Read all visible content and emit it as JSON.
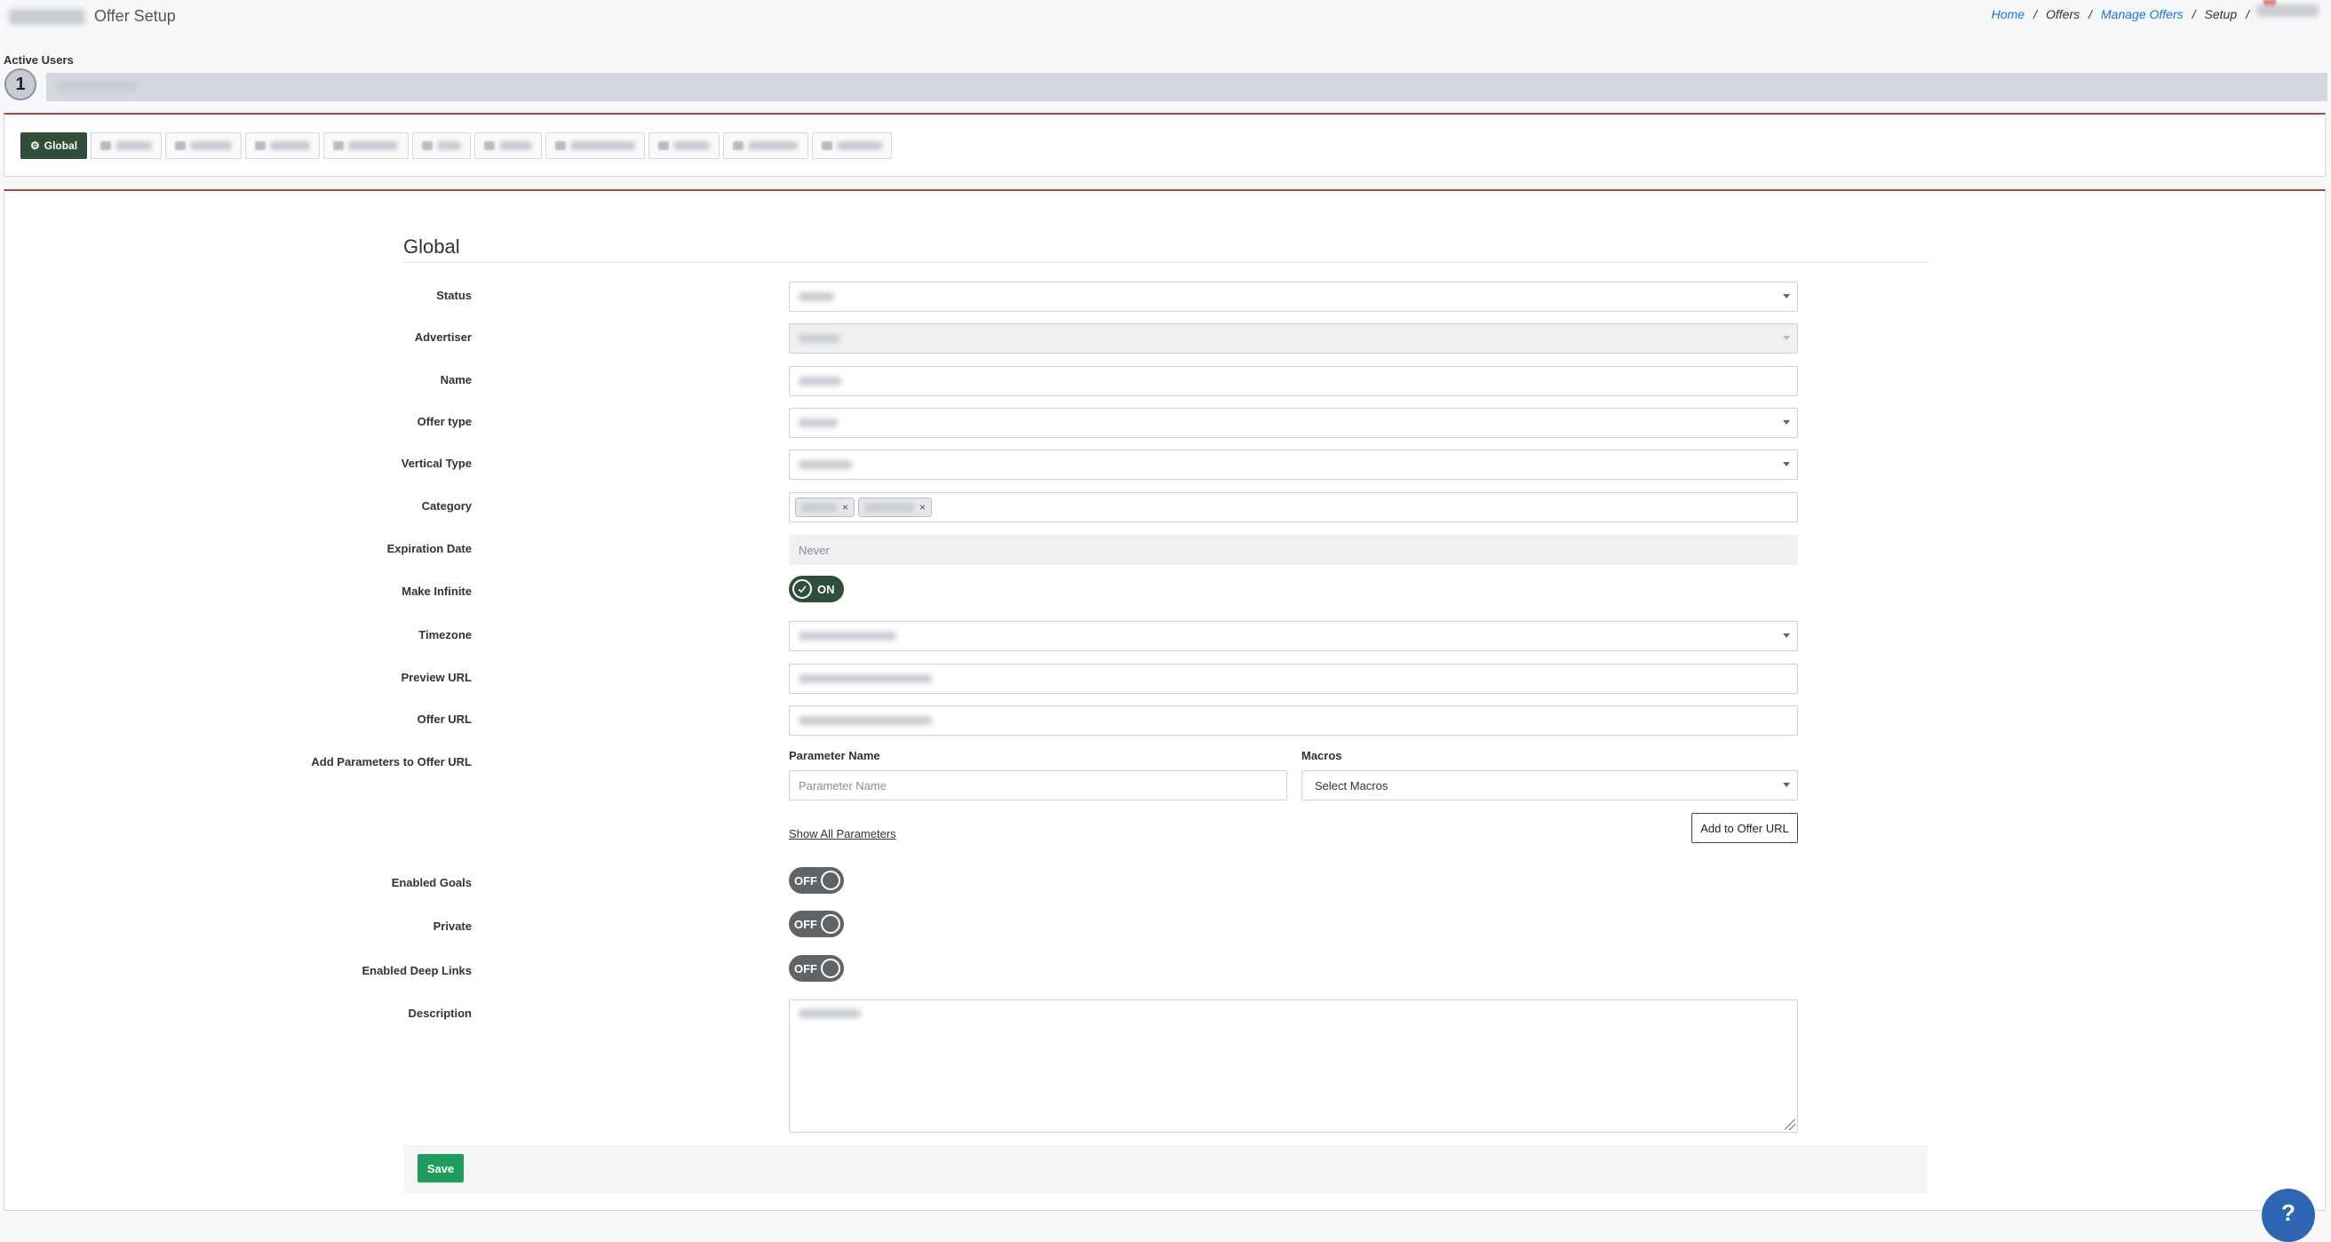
{
  "header": {
    "title": "Offer Setup",
    "breadcrumb": {
      "home": "Home",
      "offers": "Offers",
      "manage_offers": "Manage Offers",
      "setup": "Setup",
      "separator": "/"
    }
  },
  "active_users": {
    "label": "Active Users",
    "count": "1"
  },
  "tabs": {
    "global": "Global"
  },
  "form": {
    "section_title": "Global",
    "labels": {
      "status": "Status",
      "advertiser": "Advertiser",
      "name": "Name",
      "offer_type": "Offer type",
      "vertical_type": "Vertical Type",
      "category": "Category",
      "expiration_date": "Expiration Date",
      "make_infinite": "Make Infinite",
      "timezone": "Timezone",
      "preview_url": "Preview URL",
      "offer_url": "Offer URL",
      "add_parameters": "Add Parameters to Offer URL",
      "enabled_goals": "Enabled Goals",
      "private": "Private",
      "enabled_deep_links": "Enabled Deep Links",
      "description": "Description"
    },
    "category_remove_glyph": "×",
    "expiration_date_placeholder": "Never",
    "make_infinite_state": "ON",
    "parameters": {
      "param_name_label": "Parameter Name",
      "param_name_placeholder": "Parameter Name",
      "macros_label": "Macros",
      "macros_selected": "Select Macros",
      "show_all": "Show All Parameters",
      "add_button": "Add to Offer URL"
    },
    "enabled_goals_state": "OFF",
    "private_state": "OFF",
    "enabled_deep_links_state": "OFF",
    "save_label": "Save"
  },
  "help_fab": "?",
  "colors": {
    "accent_green_dark": "#2f4f3a",
    "save_green": "#1e9e5e",
    "panel_top_border": "#b8452f",
    "link_blue": "#1a73e8",
    "help_blue": "#2f66b3"
  },
  "icons": {
    "global_tab": "gear-icon",
    "dropdown": "chevron-down-icon",
    "toggle_on": "check-circle-icon",
    "help": "question-icon"
  }
}
